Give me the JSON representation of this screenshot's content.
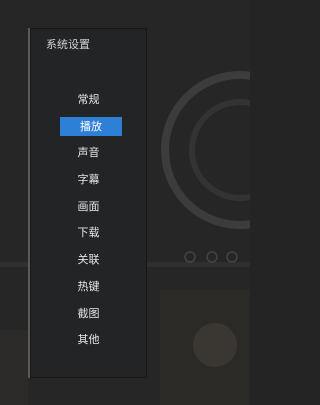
{
  "panel": {
    "title": "系统设置"
  },
  "menu": {
    "selected": "播放",
    "items": [
      {
        "label": "常规"
      },
      {
        "label": "播放"
      },
      {
        "label": "声音"
      },
      {
        "label": "字幕"
      },
      {
        "label": "画面"
      },
      {
        "label": "下载"
      },
      {
        "label": "关联"
      },
      {
        "label": "热键"
      },
      {
        "label": "截图"
      },
      {
        "label": "其他"
      }
    ]
  },
  "colors": {
    "panel_bg": "#232426",
    "selected_bg": "#2e7fd6",
    "text": "#e3e5ea"
  }
}
